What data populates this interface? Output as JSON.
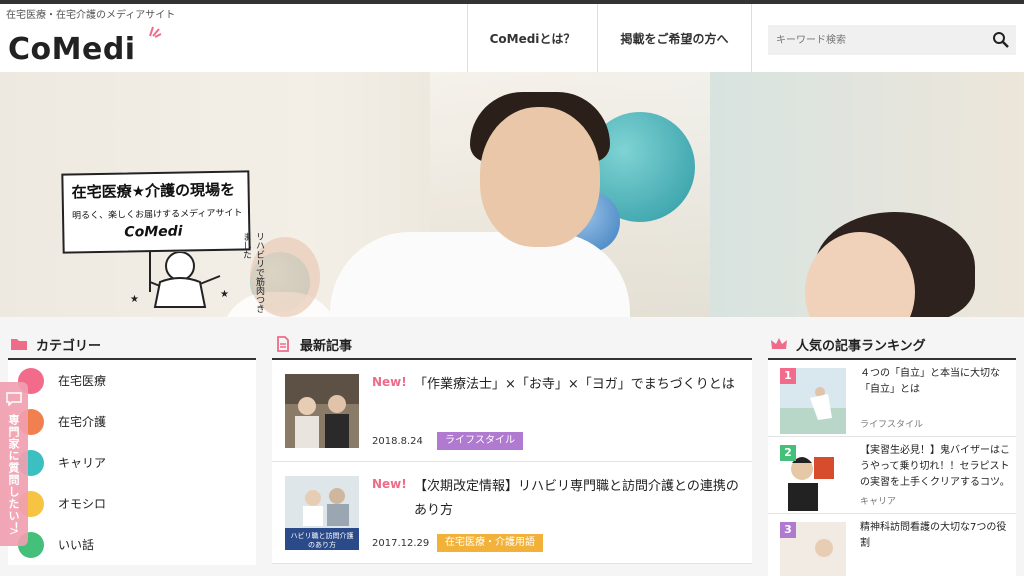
{
  "header": {
    "tagline": "在宅医療・在宅介護のメディアサイト",
    "logo": "CoMedi",
    "nav": [
      {
        "label": "CoMediとは？"
      },
      {
        "label": "掲載をご希望の方へ"
      }
    ],
    "search": {
      "placeholder": "キーワード検索"
    }
  },
  "hero": {
    "sign_line1": "在宅医療★介護の現場を",
    "sign_line2": "明るく、楽しくお届けするメディアサイト",
    "sign_logo": "CoMedi",
    "mascot_note": "リハビリで筋肉つきました"
  },
  "categories": {
    "title": "カテゴリー",
    "items": [
      {
        "label": "在宅医療",
        "color": "#f26b8a"
      },
      {
        "label": "在宅介護",
        "color": "#f08050"
      },
      {
        "label": "キャリア",
        "color": "#3bbfc0"
      },
      {
        "label": "オモシロ",
        "color": "#f6c342"
      },
      {
        "label": "いい話",
        "color": "#44c07a"
      }
    ]
  },
  "latest": {
    "title": "最新記事",
    "posts": [
      {
        "new": "New!",
        "title": "「作業療法士」×「お寺」×「ヨガ」でまちづくりとは",
        "date": "2018.8.24",
        "tag": "ライフスタイル",
        "tag_color": "#b07ad0"
      },
      {
        "new": "New!",
        "title": "【次期改定情報】リハビリ専門職と訪問介護との連携のあり方",
        "date": "2017.12.29",
        "tag": "在宅医療・介護用語",
        "tag_color": "#f2b23a",
        "thumb_caption_1": "ハビリ職と訪問介護",
        "thumb_caption_2": "のあり方"
      }
    ]
  },
  "ranking": {
    "title": "人気の記事ランキング",
    "items": [
      {
        "rank": "1",
        "title": "４つの「自立」と本当に大切な「自立」とは",
        "category": "ライフスタイル",
        "badge_color": "#f26b8a"
      },
      {
        "rank": "2",
        "title": "【実習生必見！】鬼バイザーはこうやって乗り切れ！！セラピストの実習を上手くクリアするコツ。",
        "category": "キャリア",
        "badge_color": "#44c07a"
      },
      {
        "rank": "3",
        "title": "精神科訪問看護の大切な7つの役割",
        "category": "",
        "badge_color": "#b07ad0"
      }
    ]
  },
  "side_tab": {
    "label": "専門家に質問したい！",
    "arrow": ">"
  }
}
